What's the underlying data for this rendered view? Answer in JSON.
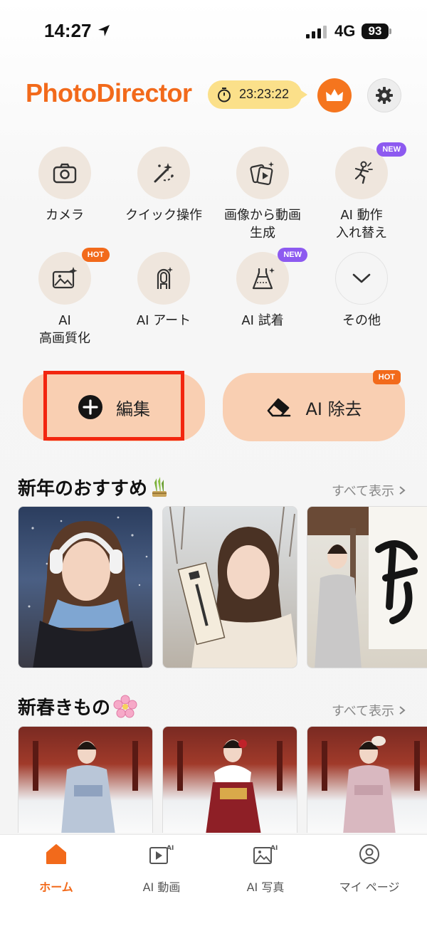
{
  "status": {
    "time": "14:27",
    "network": "4G",
    "battery": "93"
  },
  "header": {
    "logo": "PhotoDirector",
    "timer": "23:23:22"
  },
  "features": [
    {
      "label": "カメラ",
      "icon": "camera-icon",
      "badge": ""
    },
    {
      "label": "クイック操作",
      "icon": "magic-wand-icon",
      "badge": ""
    },
    {
      "label": "画像から動画\n生成",
      "icon": "image-to-video-icon",
      "badge": ""
    },
    {
      "label": "AI 動作\n入れ替え",
      "icon": "motion-swap-icon",
      "badge": "NEW"
    },
    {
      "label": "AI\n高画質化",
      "icon": "enhance-icon",
      "badge": "HOT"
    },
    {
      "label": "AI アート",
      "icon": "ai-art-icon",
      "badge": ""
    },
    {
      "label": "AI 試着",
      "icon": "dress-icon",
      "badge": "NEW"
    },
    {
      "label": "その他",
      "icon": "chevron-down-icon",
      "badge": ""
    }
  ],
  "actions": {
    "edit": "編集",
    "remove": "AI 除去",
    "remove_badge": "HOT"
  },
  "sections": [
    {
      "title": "新年のおすすめ",
      "see_all": "すべて表示"
    },
    {
      "title": "新春きもの",
      "see_all": "すべて表示"
    }
  ],
  "tabs": [
    {
      "label": "ホーム",
      "icon": "home-icon"
    },
    {
      "label": "AI 動画",
      "icon": "ai-video-icon"
    },
    {
      "label": "AI 写真",
      "icon": "ai-photo-icon"
    },
    {
      "label": "マイ ページ",
      "icon": "profile-icon"
    }
  ],
  "colors": {
    "accent": "#f26a1b",
    "button_bg": "#f9cfb2",
    "new_badge": "#8d5af0",
    "highlight": "#f2260f"
  }
}
